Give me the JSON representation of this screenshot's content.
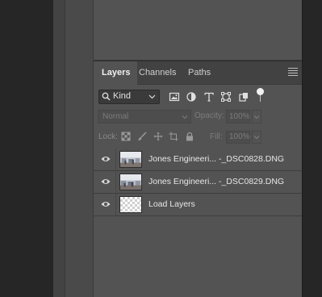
{
  "tabs": [
    {
      "label": "Layers",
      "active": true
    },
    {
      "label": "Channels",
      "active": false
    },
    {
      "label": "Paths",
      "active": false
    }
  ],
  "filter": {
    "kind_label": "Kind",
    "icons": [
      "image-filter-icon",
      "adjustment-filter-icon",
      "type-filter-icon",
      "shape-filter-icon",
      "smart-object-filter-icon"
    ]
  },
  "blend": {
    "mode": "Normal",
    "opacity_label": "Opacity:",
    "opacity_value": "100%"
  },
  "lock": {
    "label": "Lock:",
    "icons": [
      "lock-transparent-pixels-icon",
      "lock-image-pixels-icon",
      "lock-position-icon",
      "lock-artboard-icon",
      "lock-all-icon"
    ],
    "fill_label": "Fill:",
    "fill_value": "100%"
  },
  "layers": [
    {
      "name": "Jones Engineeri...  -_DSC0828.DNG",
      "visible": true,
      "thumbnail": "photo"
    },
    {
      "name": "Jones Engineeri...  -_DSC0829.DNG",
      "visible": true,
      "thumbnail": "photo"
    },
    {
      "name": "Load Layers",
      "visible": true,
      "thumbnail": "transparent"
    }
  ],
  "colors": {
    "panel_bg": "#535353",
    "tabbar_bg": "#424242",
    "app_bg": "#2a2a2a"
  }
}
